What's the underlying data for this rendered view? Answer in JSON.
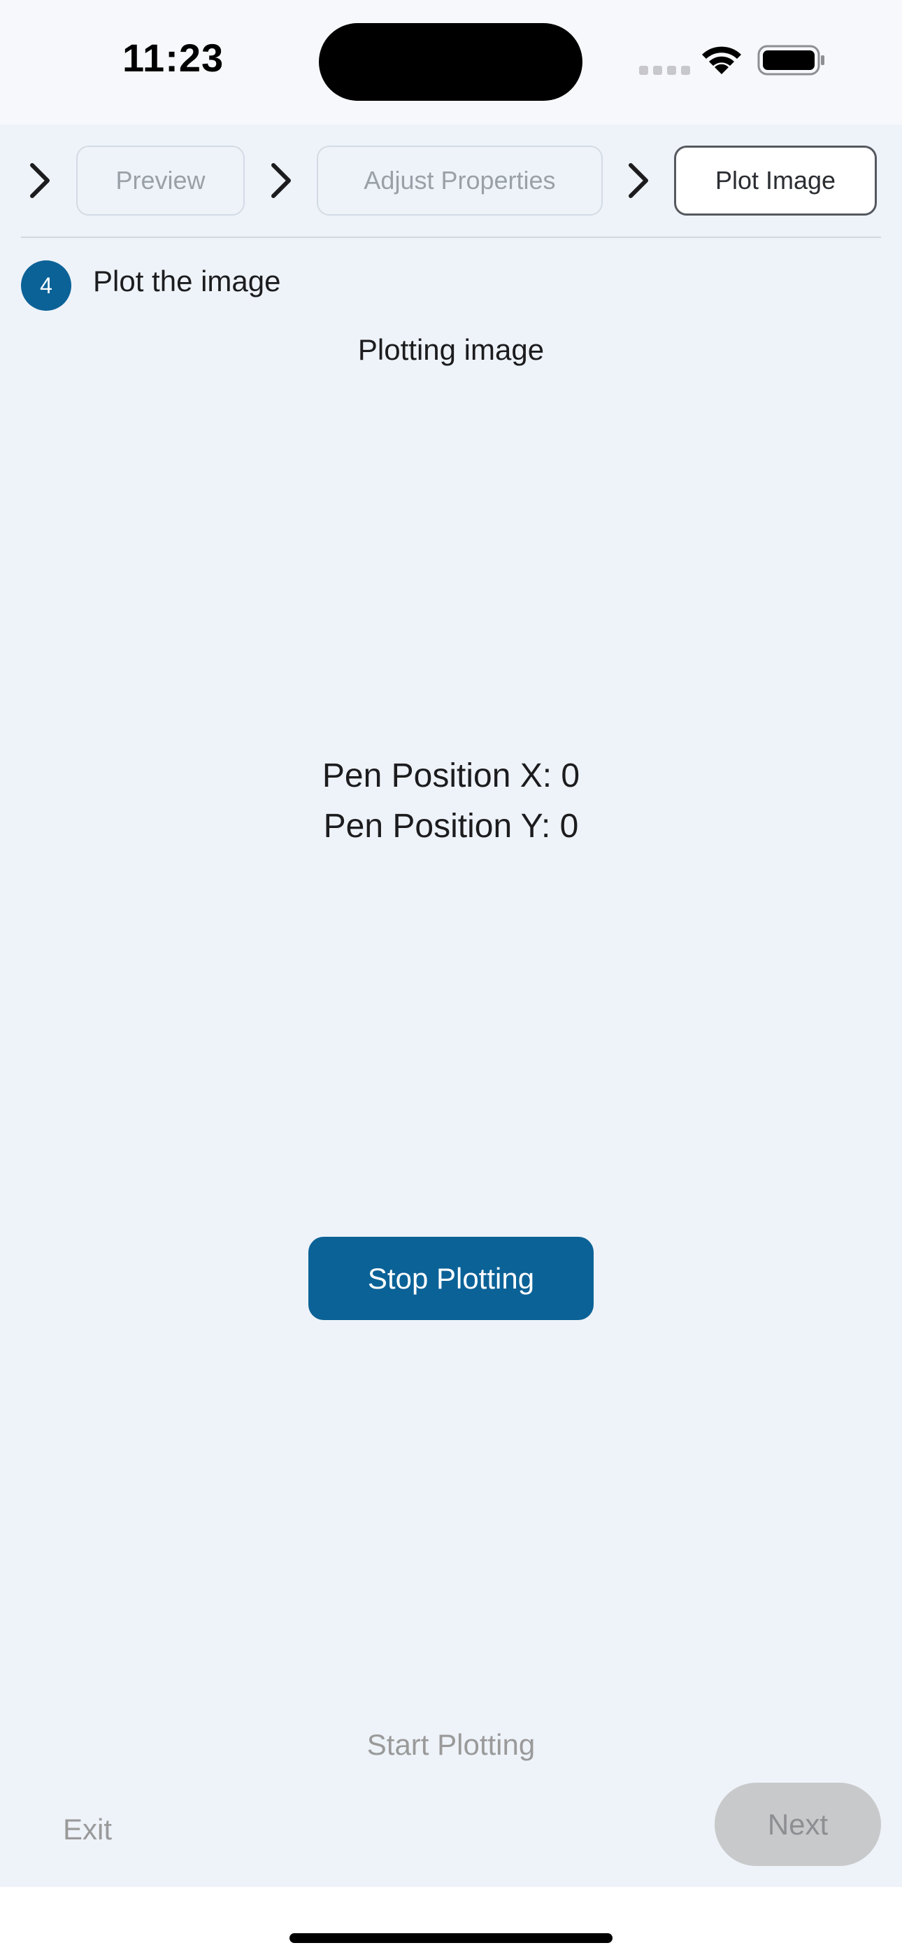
{
  "status_bar": {
    "time": "11:23",
    "icons": [
      "cellular-signal-icon",
      "wifi-icon",
      "battery-icon"
    ]
  },
  "stepper": {
    "steps": [
      {
        "label": "Preview",
        "state": "inactive"
      },
      {
        "label": "Adjust Properties",
        "state": "inactive"
      },
      {
        "label": "Plot Image",
        "state": "active"
      }
    ],
    "separator_icon": "chevron-right-icon"
  },
  "step": {
    "number": "4",
    "title": "Plot the image"
  },
  "plot": {
    "status": "Plotting image",
    "pen_x": "Pen Position X: 0",
    "pen_y": "Pen Position Y: 0",
    "stop_label": "Stop Plotting",
    "start_label": "Start Plotting"
  },
  "footer": {
    "exit_label": "Exit",
    "next_label": "Next"
  },
  "colors": {
    "accent": "#0b6297",
    "background": "#eef3f9",
    "disabled_text": "#9a9a9a",
    "disabled_button": "#c8c9cb"
  }
}
